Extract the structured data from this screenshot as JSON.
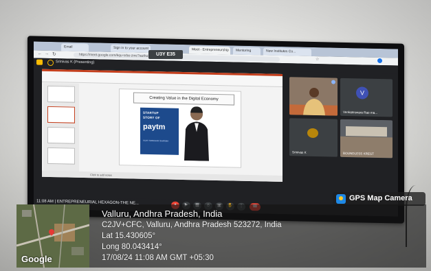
{
  "browser": {
    "tabs": [
      {
        "label": "Email"
      },
      {
        "label": "Sign in to your account"
      },
      {
        "label": "Meet - Entrepreneurship"
      },
      {
        "label": "Mentoring"
      },
      {
        "label": "New Institutes Co..."
      }
    ],
    "url": "https://meet.google.com/kqu-srbe-zmc?authuser=0",
    "overlay_badge": "U3Y E35"
  },
  "meet": {
    "presenting_label": "Srinivas K (Presenting)",
    "meeting_time": "11:08 AM",
    "meeting_name": "ENTREPRENEURIAL HEXAGON-THE NE..."
  },
  "slide": {
    "title": "Creating Value in the Digital Economy",
    "poster_line1": "STARTUP",
    "poster_line2": "STORY OF",
    "brand": "paytm",
    "poster_subtitle": "VIJAY SHEKHAR SHARMA",
    "notes_placeholder": "Click to add notes"
  },
  "participants": [
    {
      "name": ""
    },
    {
      "name": "Venkateswara Rao ma...",
      "initial": "V"
    },
    {
      "name": "Srinivas K"
    },
    {
      "name": "BOUNDLESS KREST"
    }
  ],
  "gps": {
    "app_name": "GPS Map Camera",
    "map_provider": "Google",
    "place": "Valluru, Andhra Pradesh, India",
    "address": "C2JV+CFC, Valluru, Andhra Pradesh 523272, India",
    "lat": "Lat 15.430605°",
    "long": "Long 80.043414°",
    "datetime": "17/08/24 11:08 AM GMT +05:30"
  },
  "colors": {
    "meet_bg": "#202124",
    "end_call": "#ea4335",
    "paytm_blue": "#1d4a8c",
    "avatar": "#3f51b5"
  }
}
